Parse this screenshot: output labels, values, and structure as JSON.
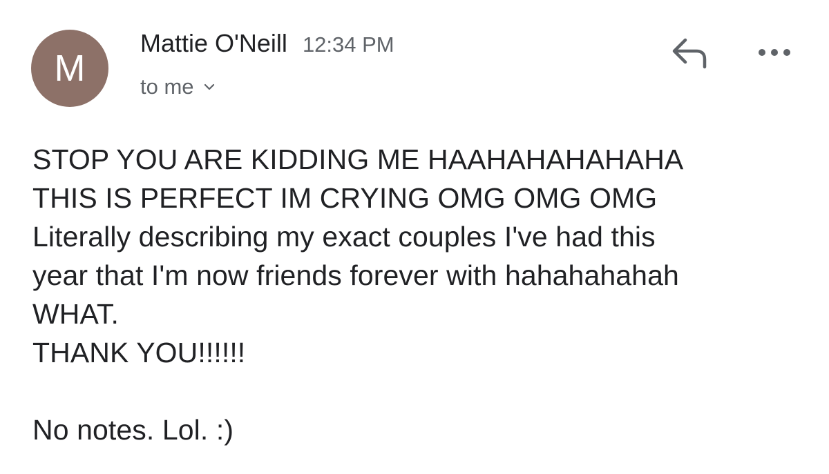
{
  "header": {
    "avatar_letter": "M",
    "avatar_color": "#8d7168",
    "sender_name": "Mattie O'Neill",
    "time": "12:34 PM",
    "recipient": "to me"
  },
  "actions": {
    "reply_icon": "reply-icon",
    "more_icon": "more-horizontal-icon",
    "expand_icon": "chevron-down-icon"
  },
  "body": {
    "lines": [
      "STOP YOU ARE KIDDING ME HAAHAHAHAHAHA",
      "THIS IS PERFECT IM CRYING OMG OMG OMG",
      "Literally describing my exact couples I've had this",
      "year that I'm now friends forever with hahahahahah",
      "WHAT.",
      "THANK YOU!!!!!!",
      "",
      "No notes. Lol. :)"
    ]
  }
}
